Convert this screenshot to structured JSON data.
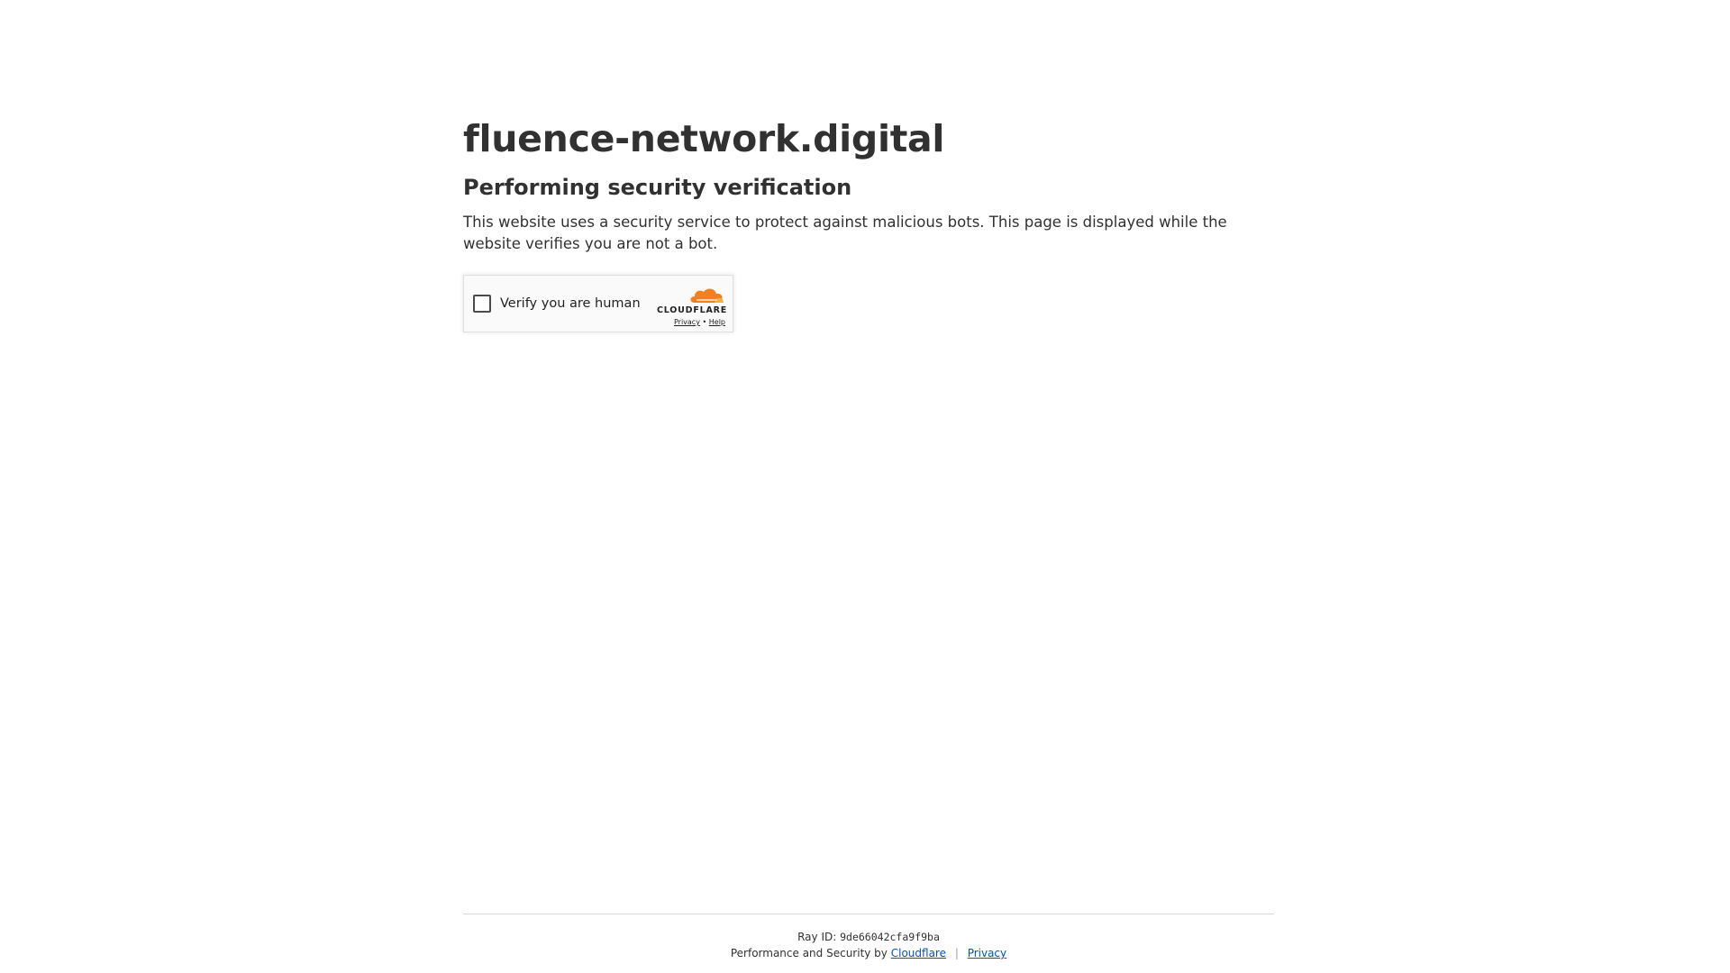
{
  "page": {
    "site_title": "fluence-network.digital",
    "subtitle": "Performing security verification",
    "description": "This website uses a security service to protect against malicious bots. This page is displayed while the website verifies you are not a bot."
  },
  "widget": {
    "checkbox_label": "Verify you are human",
    "brand_name": "CLOUDFLARE",
    "brand_icon": "cloud-icon",
    "privacy_link": "Privacy",
    "separator": "•",
    "help_link": "Help",
    "brand_color": "#f38020"
  },
  "footer": {
    "ray_label": "Ray ID:",
    "ray_id": "9de66042cfa9f9ba",
    "perf_text": "Performance and Security by",
    "cloudflare_link": "Cloudflare",
    "separator": "|",
    "privacy_link": "Privacy",
    "link_color": "#0051c3"
  }
}
